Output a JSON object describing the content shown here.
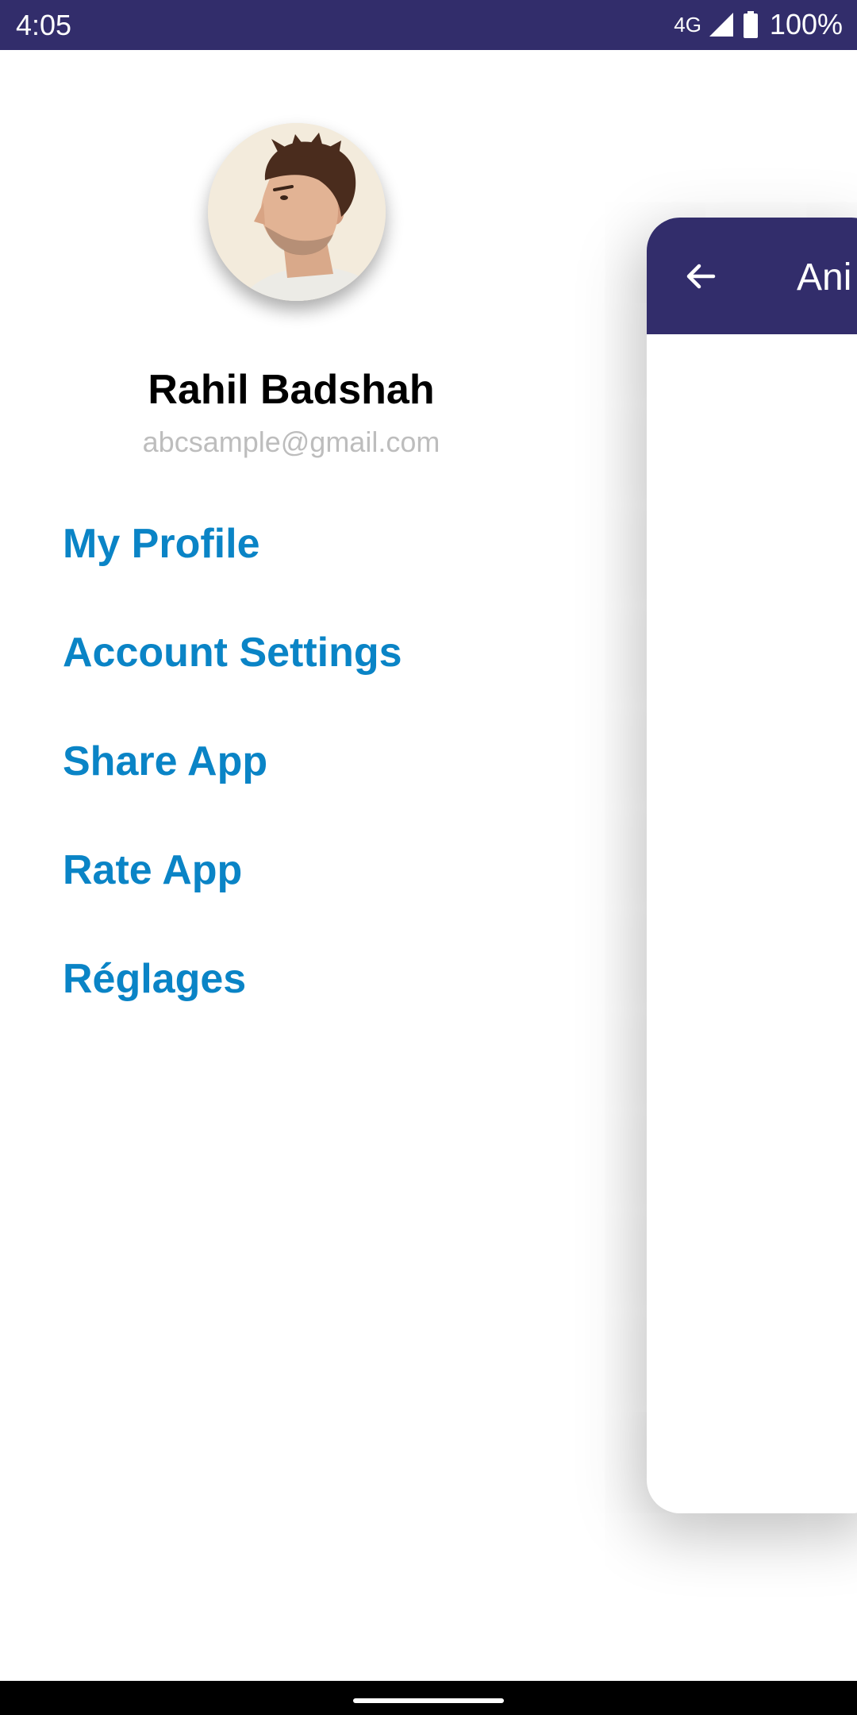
{
  "status_bar": {
    "time": "4:05",
    "network": "4G",
    "battery": "100%",
    "background": "#322d6b"
  },
  "drawer": {
    "user_name": "Rahil Badshah",
    "user_email": "abcsample@gmail.com",
    "menu_items": [
      {
        "label": "My Profile"
      },
      {
        "label": "Account Settings"
      },
      {
        "label": "Share App"
      },
      {
        "label": "Rate App"
      },
      {
        "label": "Réglages"
      }
    ],
    "menu_color": "#0a84c6"
  },
  "content_card": {
    "toolbar_title": "Ani",
    "toolbar_color": "#322d6b",
    "back_icon": "arrow-left-icon"
  }
}
